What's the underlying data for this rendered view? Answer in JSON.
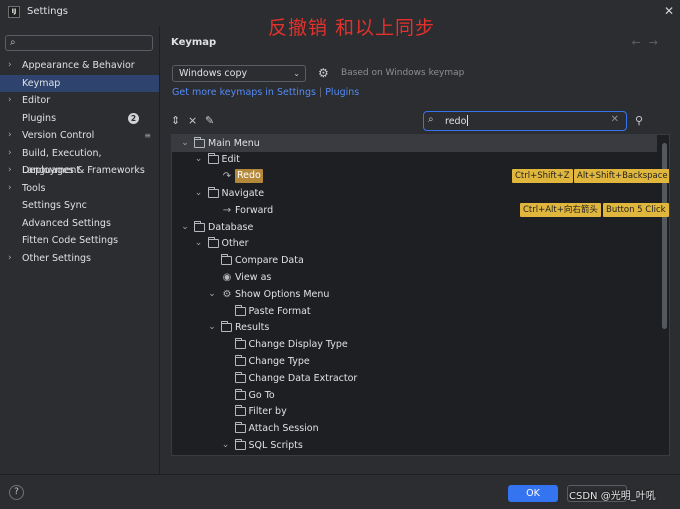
{
  "window": {
    "title": "Settings",
    "app_icon_text": "IJ"
  },
  "annotation": "反撤销  和以上同步",
  "sidebar": {
    "search_placeholder": "",
    "items": [
      {
        "label": "Appearance & Behavior",
        "expandable": true
      },
      {
        "label": "Keymap",
        "selected": true
      },
      {
        "label": "Editor",
        "expandable": true
      },
      {
        "label": "Plugins",
        "badge": "2"
      },
      {
        "label": "Version Control",
        "expandable": true
      },
      {
        "label": "Build, Execution, Deployment",
        "expandable": true
      },
      {
        "label": "Languages & Frameworks",
        "expandable": true
      },
      {
        "label": "Tools",
        "expandable": true
      },
      {
        "label": "Settings Sync"
      },
      {
        "label": "Advanced Settings"
      },
      {
        "label": "Fitten Code Settings"
      },
      {
        "label": "Other Settings",
        "expandable": true
      }
    ]
  },
  "main": {
    "heading": "Keymap",
    "keymap_select": "Windows copy",
    "based_on": "Based on Windows keymap",
    "link_more": "Get more keymaps in Settings",
    "link_sep": "|",
    "link_plugins": "Plugins",
    "filter_value": "redo",
    "tree": [
      {
        "label": "Main Menu",
        "type": "folder",
        "depth": 0,
        "expanded": true
      },
      {
        "label": "Edit",
        "type": "folder",
        "depth": 1,
        "expanded": true
      },
      {
        "label": "Redo",
        "type": "action",
        "icon": "redo-icon",
        "depth": 2,
        "match": true,
        "shortcuts": [
          "Ctrl+Shift+Z",
          "Alt+Shift+Backspace"
        ]
      },
      {
        "label": "Navigate",
        "type": "folder",
        "depth": 1,
        "expanded": true
      },
      {
        "label": "Forward",
        "type": "action",
        "icon": "arrow-right-icon",
        "depth": 2,
        "shortcuts": [
          "Ctrl+Alt+向右箭头",
          "Button 5 Click"
        ]
      },
      {
        "label": "Database",
        "type": "folder",
        "depth": 0,
        "expanded": true
      },
      {
        "label": "Other",
        "type": "folder",
        "depth": 1,
        "expanded": true
      },
      {
        "label": "Compare Data",
        "type": "folder",
        "depth": 2
      },
      {
        "label": "View as",
        "type": "action",
        "icon": "eye-icon",
        "depth": 2
      },
      {
        "label": "Show Options Menu",
        "type": "action",
        "icon": "gear-icon",
        "depth": 2,
        "expanded": true
      },
      {
        "label": "Paste Format",
        "type": "folder",
        "depth": 3
      },
      {
        "label": "Results",
        "type": "folder",
        "depth": 2,
        "expanded": true
      },
      {
        "label": "Change Display Type",
        "type": "folder",
        "depth": 3
      },
      {
        "label": "Change Type",
        "type": "folder",
        "depth": 3
      },
      {
        "label": "Change Data Extractor",
        "type": "folder",
        "depth": 3
      },
      {
        "label": "Go To",
        "type": "folder",
        "depth": 3
      },
      {
        "label": "Filter by",
        "type": "folder",
        "depth": 3
      },
      {
        "label": "Attach Session",
        "type": "folder",
        "depth": 3
      },
      {
        "label": "SQL Scripts",
        "type": "folder",
        "depth": 3,
        "expanded": true
      }
    ]
  },
  "footer": {
    "help": "?",
    "ok_label": "OK",
    "watermark": "CSDN @光明_叶吼"
  }
}
